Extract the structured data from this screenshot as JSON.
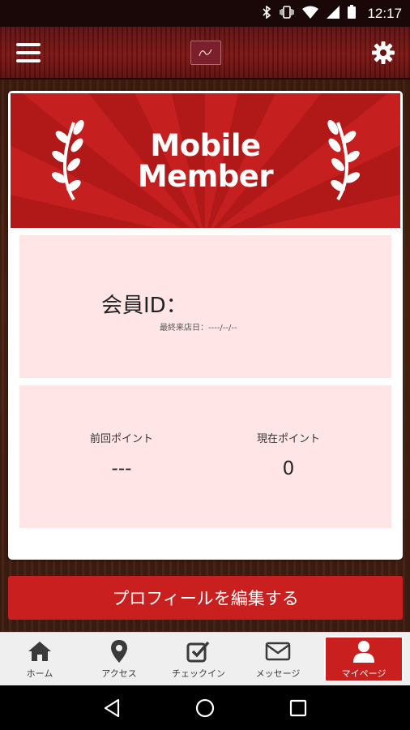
{
  "status_bar": {
    "time": "12:17",
    "icons": [
      "bluetooth-icon",
      "vibrate-icon",
      "wifi-icon",
      "cellular-icon",
      "battery-icon"
    ]
  },
  "header": {
    "menu_icon": "hamburger-menu-icon",
    "logo": "shop-logo",
    "settings_icon": "gear-icon"
  },
  "card": {
    "banner_line1": "Mobile",
    "banner_line2": "Member",
    "member_id_label": "会員ID：",
    "last_visit": "最終来店日：----/--/--",
    "prev_points_label": "前回ポイント",
    "prev_points_value": "---",
    "current_points_label": "現在ポイント",
    "current_points_value": "0"
  },
  "edit_profile_label": "プロフィールを編集する",
  "tabs": [
    {
      "label": "ホーム",
      "icon": "home-icon"
    },
    {
      "label": "アクセス",
      "icon": "map-pin-icon"
    },
    {
      "label": "チェックイン",
      "icon": "checkbox-icon"
    },
    {
      "label": "メッセージ",
      "icon": "envelope-icon"
    },
    {
      "label": "マイページ",
      "icon": "person-icon",
      "active": true
    }
  ],
  "colors": {
    "accent": "#c91f1f",
    "panel": "#ffe5e5",
    "header": "#6b1210"
  }
}
